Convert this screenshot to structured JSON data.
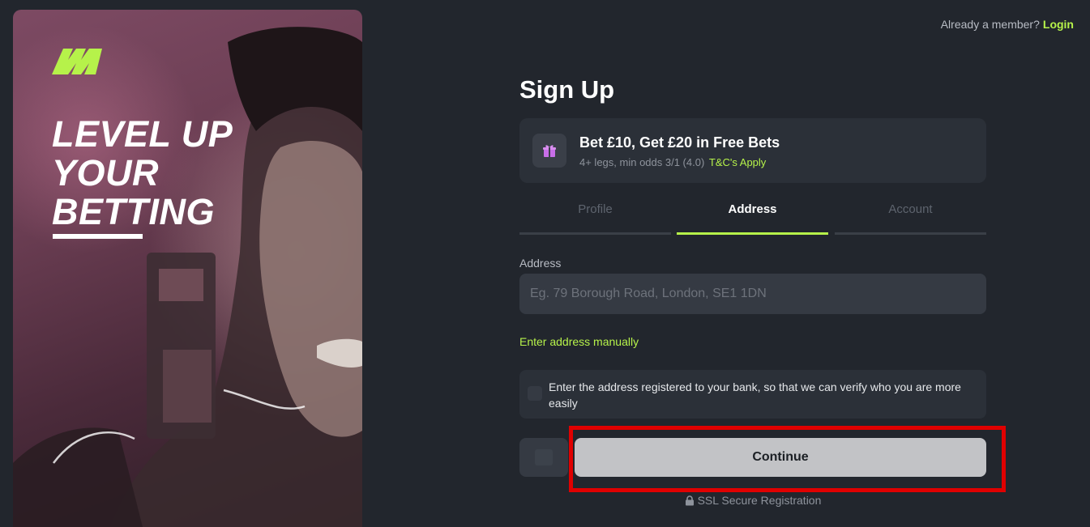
{
  "hero": {
    "headline": [
      "LEVEL UP",
      "YOUR",
      "BETTING"
    ],
    "logo": "brand-logo",
    "accent_color": "#b6f24a"
  },
  "header": {
    "member_prompt": "Already a member?",
    "login_link": "Login"
  },
  "form": {
    "title": "Sign Up",
    "promo": {
      "title": "Bet £10, Get £20 in Free Bets",
      "subtitle": "4+ legs, min odds 3/1 (4.0)",
      "terms_link": "T&C's Apply",
      "icon": "gift-icon"
    },
    "tabs": [
      {
        "label": "Profile",
        "active": false
      },
      {
        "label": "Address",
        "active": true
      },
      {
        "label": "Account",
        "active": false
      }
    ],
    "address": {
      "label": "Address",
      "placeholder": "Eg. 79 Borough Road, London, SE1 1DN",
      "value": ""
    },
    "manual_link": "Enter address manually",
    "info_note": "Enter the address registered to your bank, so that we can verify who you are more easily",
    "continue_label": "Continue",
    "secure_text": "SSL Secure Registration"
  },
  "colors": {
    "background": "#22262d",
    "panel": "#2b3038",
    "accent": "#b6f24a",
    "highlight": "#e00000",
    "button": "#c2c3c6"
  }
}
